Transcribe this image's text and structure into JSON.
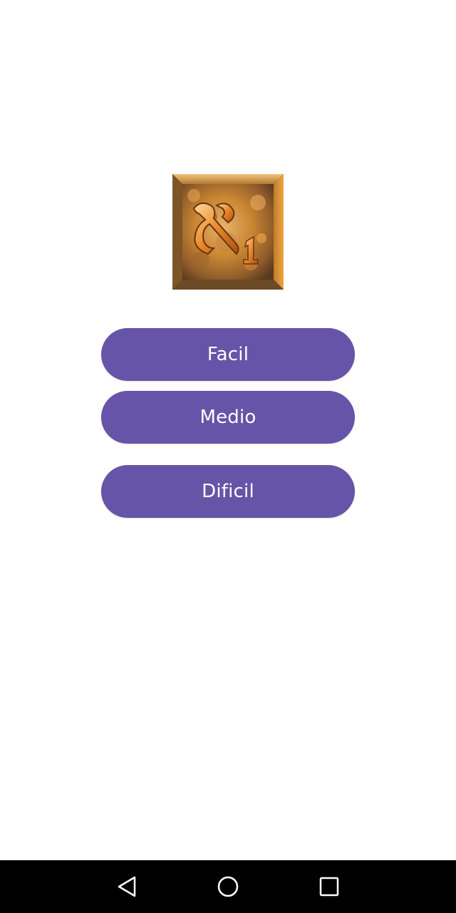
{
  "app": {
    "logo": {
      "icon": "game-tile-logo-icon",
      "glyph_text": "ℵ1"
    }
  },
  "levels": {
    "easy_label": "Facil",
    "medium_label": "Medio",
    "hard_label": "Dificil"
  },
  "colors": {
    "button_background": "#6554a7",
    "button_text": "#ffffff",
    "background": "#ffffff",
    "navbar": "#000000"
  },
  "system_nav": {
    "back_icon": "back-triangle-icon",
    "home_icon": "home-circle-icon",
    "recents_icon": "recents-square-icon"
  }
}
